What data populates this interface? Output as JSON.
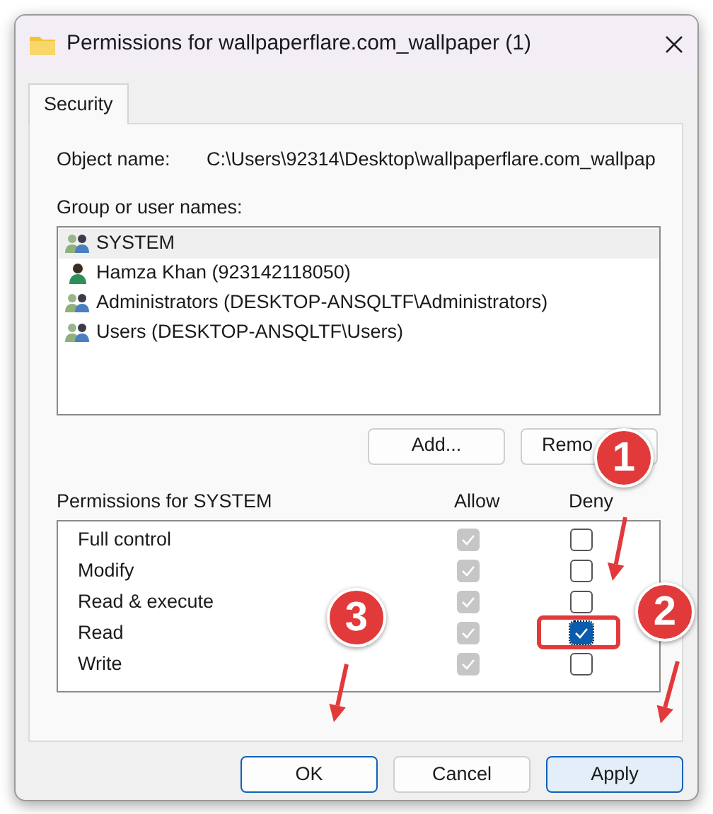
{
  "window": {
    "title": "Permissions for wallpaperflare.com_wallpaper (1)"
  },
  "tabs": [
    {
      "label": "Security",
      "selected": true
    }
  ],
  "object_name": {
    "label": "Object name:",
    "value": "C:\\Users\\92314\\Desktop\\wallpaperflare.com_wallpap"
  },
  "group_label": "Group or user names:",
  "users": [
    {
      "name": "SYSTEM",
      "kind": "group",
      "selected": true
    },
    {
      "name": "Hamza Khan (923142118050)",
      "kind": "user",
      "selected": false
    },
    {
      "name": "Administrators (DESKTOP-ANSQLTF\\Administrators)",
      "kind": "group",
      "selected": false
    },
    {
      "name": "Users (DESKTOP-ANSQLTF\\Users)",
      "kind": "group",
      "selected": false
    }
  ],
  "user_buttons": [
    "Add...",
    "Remo"
  ],
  "permissions_header": {
    "label": "Permissions for SYSTEM",
    "allow": "Allow",
    "deny": "Deny"
  },
  "permissions": [
    {
      "name": "Full control",
      "allow_checked": true,
      "allow_disabled": true,
      "deny_checked": false
    },
    {
      "name": "Modify",
      "allow_checked": true,
      "allow_disabled": true,
      "deny_checked": false
    },
    {
      "name": "Read & execute",
      "allow_checked": true,
      "allow_disabled": true,
      "deny_checked": false
    },
    {
      "name": "Read",
      "allow_checked": true,
      "allow_disabled": true,
      "deny_checked": true
    },
    {
      "name": "Write",
      "allow_checked": true,
      "allow_disabled": true,
      "deny_checked": false
    }
  ],
  "buttons": [
    {
      "label": "OK",
      "default": true
    },
    {
      "label": "Cancel",
      "default": false
    },
    {
      "label": "Apply",
      "default": true
    }
  ],
  "callouts": [
    {
      "label": "1"
    },
    {
      "label": "2"
    },
    {
      "label": "3"
    }
  ]
}
